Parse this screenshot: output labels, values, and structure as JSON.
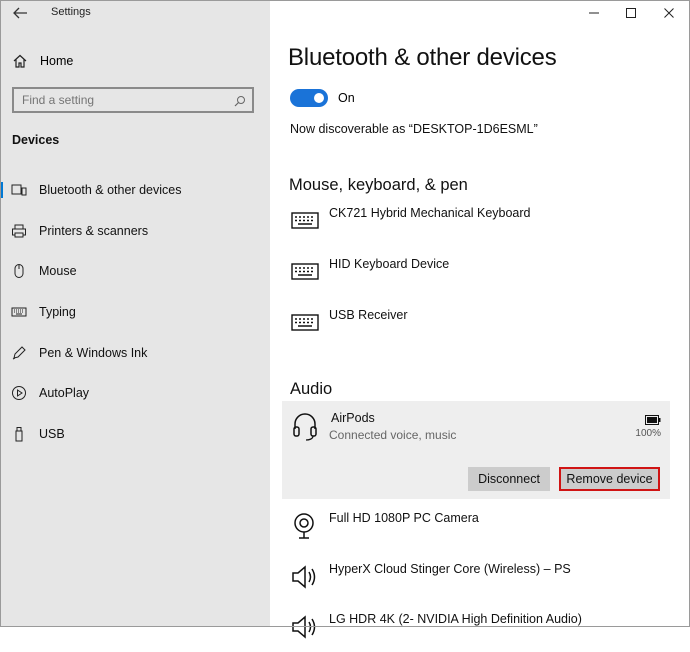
{
  "window": {
    "title": "Settings",
    "controls": [
      "minimize-icon",
      "maximize-icon",
      "close-icon"
    ]
  },
  "sidebar": {
    "home_label": "Home",
    "search": {
      "placeholder": "Find a setting",
      "value": ""
    },
    "section_label": "Devices",
    "items": [
      {
        "label": "Bluetooth & other devices",
        "icon": "bluetooth-devices-icon",
        "selected": true
      },
      {
        "label": "Printers & scanners",
        "icon": "printer-icon",
        "selected": false
      },
      {
        "label": "Mouse",
        "icon": "mouse-icon",
        "selected": false
      },
      {
        "label": "Typing",
        "icon": "keyboard-icon",
        "selected": false
      },
      {
        "label": "Pen & Windows Ink",
        "icon": "pen-icon",
        "selected": false
      },
      {
        "label": "AutoPlay",
        "icon": "autoplay-icon",
        "selected": false
      },
      {
        "label": "USB",
        "icon": "usb-icon",
        "selected": false
      }
    ]
  },
  "main": {
    "title": "Bluetooth & other devices",
    "bluetooth_toggle": {
      "state": "On",
      "on": true
    },
    "discoverable_text": "Now discoverable as “DESKTOP-1D6ESML”",
    "mouse_section": {
      "heading": "Mouse, keyboard, & pen",
      "devices": [
        {
          "name": "CK721 Hybrid Mechanical Keyboard",
          "icon": "keyboard-icon"
        },
        {
          "name": "HID Keyboard Device",
          "icon": "keyboard-icon"
        },
        {
          "name": "USB Receiver",
          "icon": "keyboard-icon"
        }
      ]
    },
    "audio_section": {
      "heading": "Audio",
      "selected_device": {
        "name": "AirPods",
        "status": "Connected voice, music",
        "battery": "100%",
        "battery_level": 1.0,
        "disconnect_label": "Disconnect",
        "remove_label": "Remove device"
      },
      "devices": [
        {
          "name": "Full HD 1080P PC Camera",
          "icon": "webcam-icon"
        },
        {
          "name": "HyperX Cloud Stinger Core (Wireless) – PS",
          "icon": "speaker-icon"
        },
        {
          "name": "LG HDR 4K (2- NVIDIA High Definition Audio)",
          "icon": "speaker-icon"
        }
      ]
    }
  },
  "colors": {
    "accent": "#0078d4",
    "toggle_on": "#1a73d8",
    "highlight_border": "#d01414",
    "sidebar_bg": "#e6e6e6"
  }
}
